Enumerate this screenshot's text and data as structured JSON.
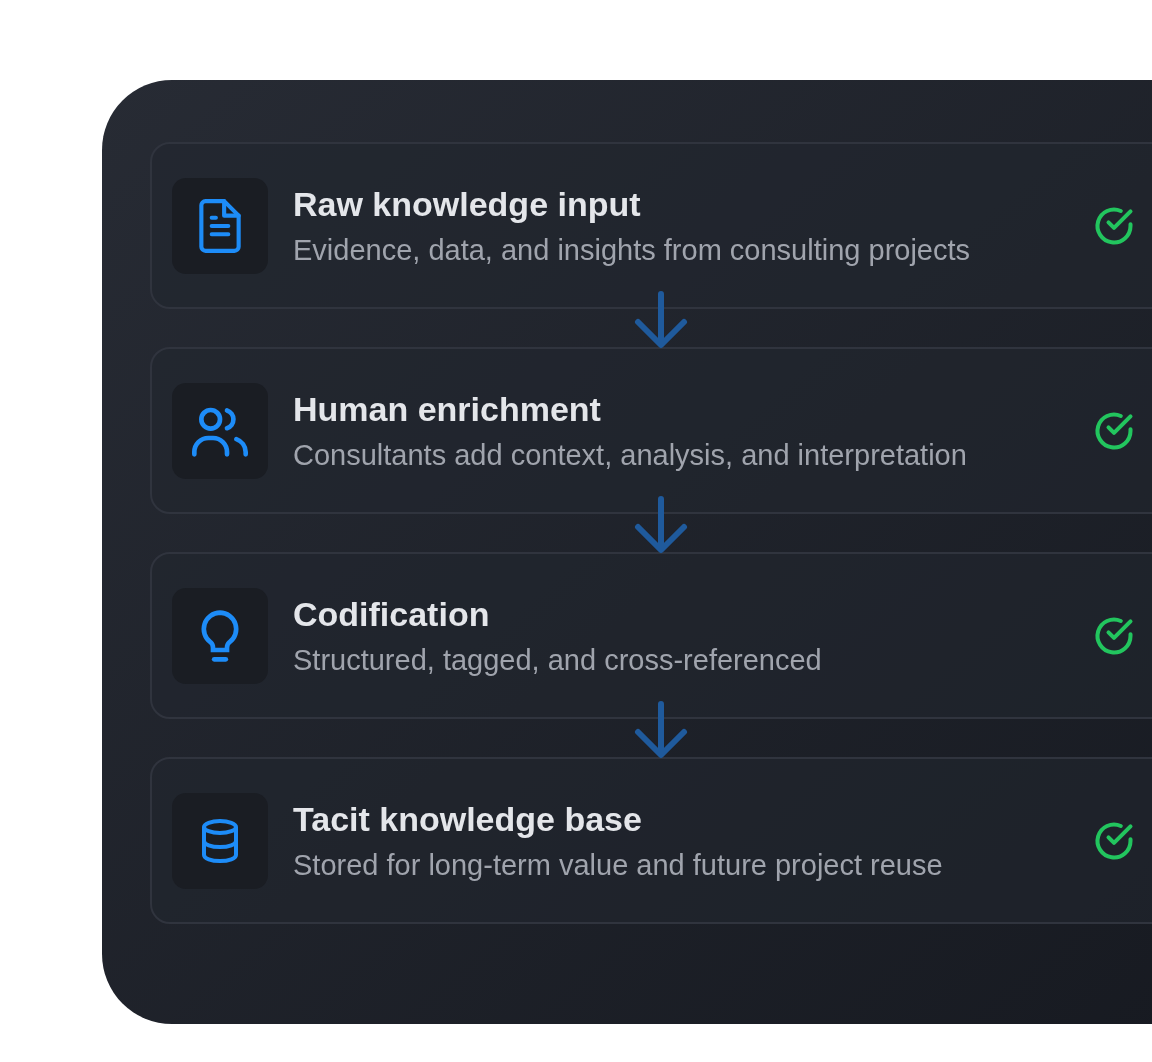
{
  "steps": [
    {
      "kind": "document",
      "title": "Raw knowledge input",
      "description": "Evidence, data, and insights from consulting projects",
      "completed": true
    },
    {
      "kind": "people",
      "title": "Human enrichment",
      "description": "Consultants add context, analysis, and interpretation",
      "completed": true
    },
    {
      "kind": "bulb",
      "title": "Codification",
      "description": "Structured, tagged, and cross-referenced",
      "completed": true
    },
    {
      "kind": "database",
      "title": "Tacit knowledge base",
      "description": "Stored for long-term value and future project reuse",
      "completed": true
    }
  ]
}
